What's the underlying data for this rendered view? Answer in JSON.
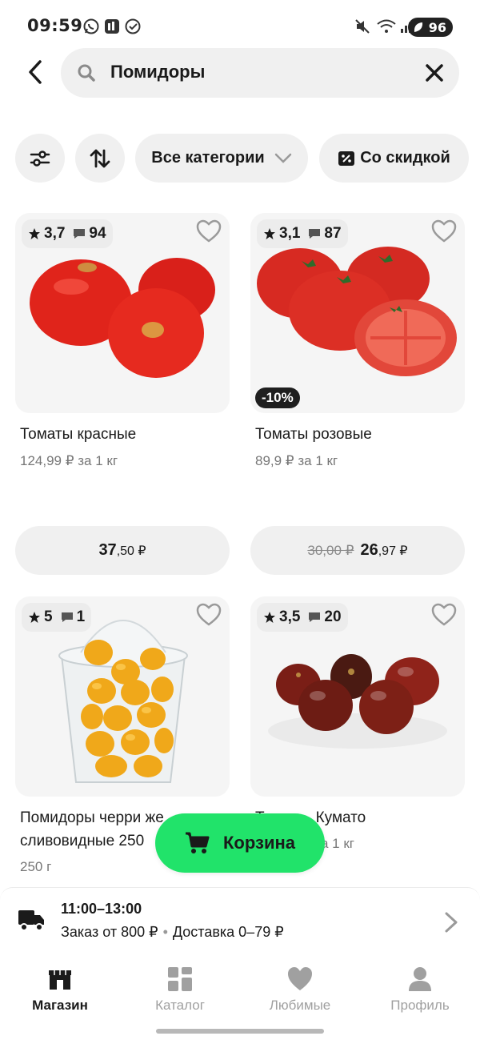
{
  "status_bar": {
    "time": "09:59",
    "battery": "96"
  },
  "search": {
    "query": "Помидоры"
  },
  "filters": {
    "categories_label": "Все категории",
    "discount_label": "Со скидкой"
  },
  "products": [
    {
      "rating": "3,7",
      "reviews": "94",
      "name": "Томаты красные",
      "unit_price": "124,99 ₽ за 1 кг",
      "price_int": "37",
      "price_frac": ",50 ₽"
    },
    {
      "rating": "3,1",
      "reviews": "87",
      "discount": "-10%",
      "name": "Томаты розовые",
      "unit_price": "89,9 ₽ за 1 кг",
      "old_price": "30,00 ₽",
      "price_int": "26",
      "price_frac": ",97 ₽"
    },
    {
      "rating": "5",
      "reviews": "1",
      "name_line1": "Помидоры черри же",
      "name_line2": "сливовидные 250",
      "unit_price": "250 г"
    },
    {
      "rating": "3,5",
      "reviews": "20",
      "name_line1": "Т",
      "name_line1b": "Кумато",
      "unit_price": "а 1 кг"
    }
  ],
  "cart": {
    "label": "Корзина"
  },
  "delivery": {
    "time": "11:00–13:00",
    "min_order": "Заказ от 800 ₽",
    "separator": "•",
    "cost": "Доставка 0–79 ₽"
  },
  "nav": {
    "shop": "Магазин",
    "catalog": "Каталог",
    "favorites": "Любимые",
    "profile": "Профиль"
  },
  "colors": {
    "accent": "#21e36a",
    "chip_bg": "#f0f0f0",
    "card_bg": "#f5f5f5",
    "tomato_red": "#e0241b"
  }
}
